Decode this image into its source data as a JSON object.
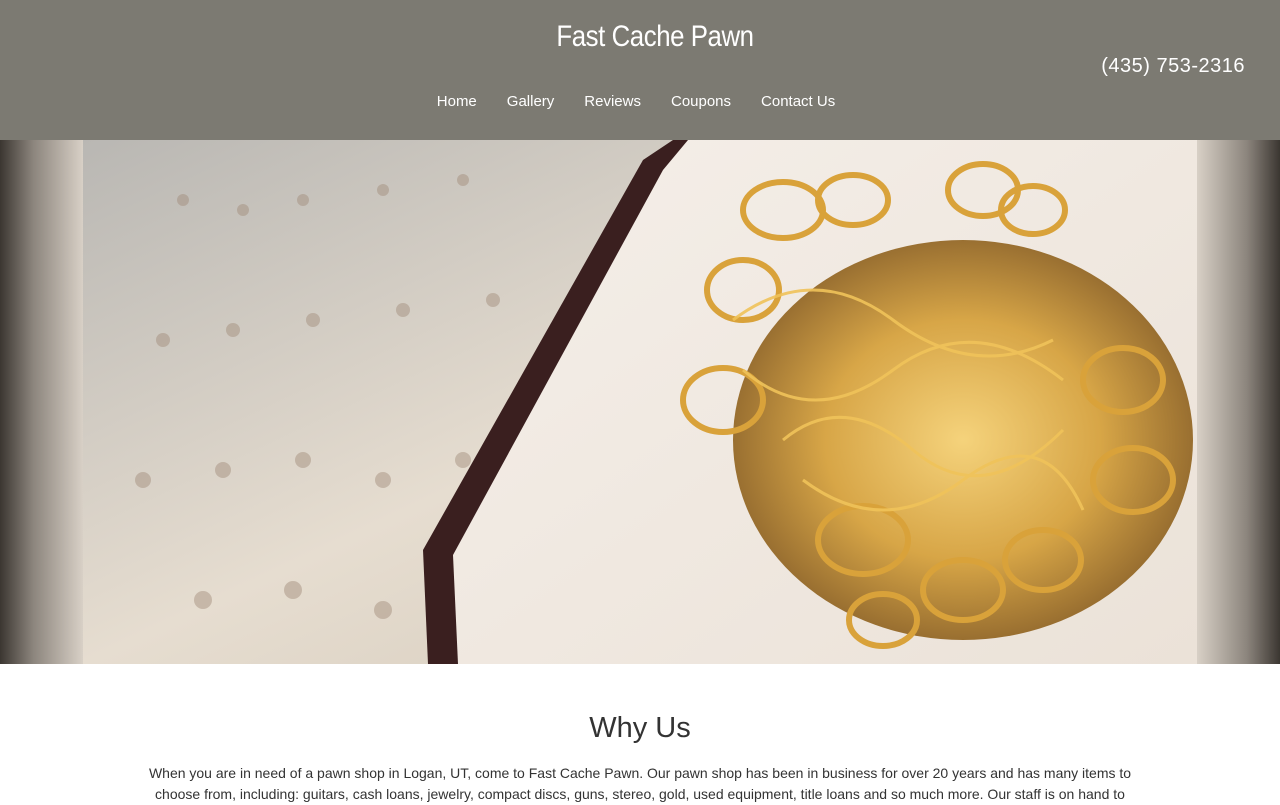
{
  "header": {
    "site_title": "Fast Cache Pawn",
    "phone": "(435) 753-2316",
    "nav": [
      {
        "label": "Home"
      },
      {
        "label": "Gallery"
      },
      {
        "label": "Reviews"
      },
      {
        "label": "Coupons"
      },
      {
        "label": "Contact Us"
      }
    ]
  },
  "hero": {
    "image_subject": "gold-jewelry-on-display-tray"
  },
  "main": {
    "section_title": "Why Us",
    "section_body": "When you are in need of a pawn shop in Logan, UT, come to Fast Cache Pawn. Our pawn shop has been in business for over 20 years and has many items to choose from, including: guitars, cash loans, jewelry, compact discs, guns, stereo, gold, used equipment, title loans and so much more. Our staff is on hand to"
  },
  "colors": {
    "header_bg": "#7c7a72",
    "header_text": "#ffffff",
    "body_text": "#333333"
  }
}
